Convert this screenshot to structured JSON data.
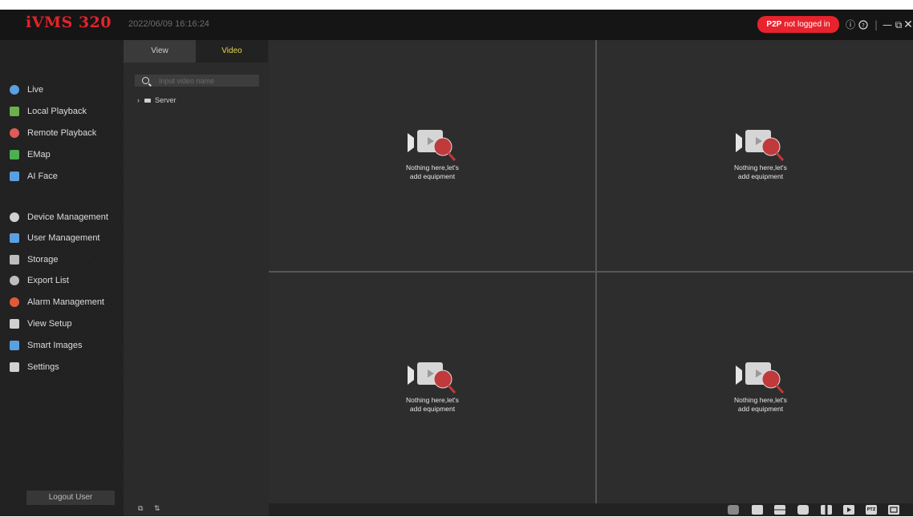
{
  "app": {
    "title": "iVMS 320",
    "datetime": "2022/06/09 16:16:24"
  },
  "status": {
    "p2p_label": "P2P",
    "p2p_state": "not logged in"
  },
  "window_controls": {
    "info": "ⓘ",
    "help": "?",
    "separator": "|",
    "minimize": "—",
    "restore": "⧉",
    "close": "✕"
  },
  "nav": {
    "items": [
      {
        "label": "Live",
        "icon": "live-icon",
        "color": "#5aa0e0"
      },
      {
        "label": "Local Playback",
        "icon": "local-playback-icon",
        "color": "#6ab04c"
      },
      {
        "label": "Remote Playback",
        "icon": "remote-playback-icon",
        "color": "#e05a5a"
      },
      {
        "label": "EMap",
        "icon": "emap-icon",
        "color": "#4caf50"
      },
      {
        "label": "AI Face",
        "icon": "ai-face-icon",
        "color": "#5aa0e0"
      },
      {
        "label": "Device Management",
        "icon": "device-management-icon",
        "color": "#d0d0d0"
      },
      {
        "label": "User Management",
        "icon": "user-management-icon",
        "color": "#5aa0e0"
      },
      {
        "label": "Storage",
        "icon": "storage-icon",
        "color": "#bdbdbd"
      },
      {
        "label": "Export List",
        "icon": "export-list-icon",
        "color": "#bdbdbd"
      },
      {
        "label": "Alarm Management",
        "icon": "alarm-management-icon",
        "color": "#e05a3a"
      },
      {
        "label": "View Setup",
        "icon": "view-setup-icon",
        "color": "#d0d0d0"
      },
      {
        "label": "Smart Images",
        "icon": "smart-images-icon",
        "color": "#5aa0e0"
      },
      {
        "label": "Settings",
        "icon": "settings-icon",
        "color": "#d0d0d0"
      }
    ],
    "logout_label": "Logout User"
  },
  "panel": {
    "tabs": [
      {
        "label": "View"
      },
      {
        "label": "Video"
      }
    ],
    "active_tab": "Video",
    "search_placeholder": "Input video name",
    "tree": [
      {
        "label": "Server",
        "expanded": false
      }
    ],
    "footer": {
      "left_icon": "split-icon",
      "right_icon": "sort-icon"
    }
  },
  "grid": {
    "layout": "2x2",
    "cells": [
      {
        "line1": "Nothing here,let's",
        "line2": "add equipment"
      },
      {
        "line1": "Nothing here,let's",
        "line2": "add equipment"
      },
      {
        "line1": "Nothing here,let's",
        "line2": "add equipment"
      },
      {
        "line1": "Nothing here,let's",
        "line2": "add equipment"
      }
    ]
  },
  "toolbar": {
    "buttons": [
      "screenshot-icon",
      "single-screen-icon",
      "multi-screen-icon",
      "camera-icon",
      "pause-icon",
      "play-icon",
      "ptz-icon",
      "fullscreen-icon"
    ],
    "ptz_label": "PTZ"
  },
  "colors": {
    "accent": "#e2232a",
    "tab_active": "#e9d44a",
    "background": "#262626"
  }
}
